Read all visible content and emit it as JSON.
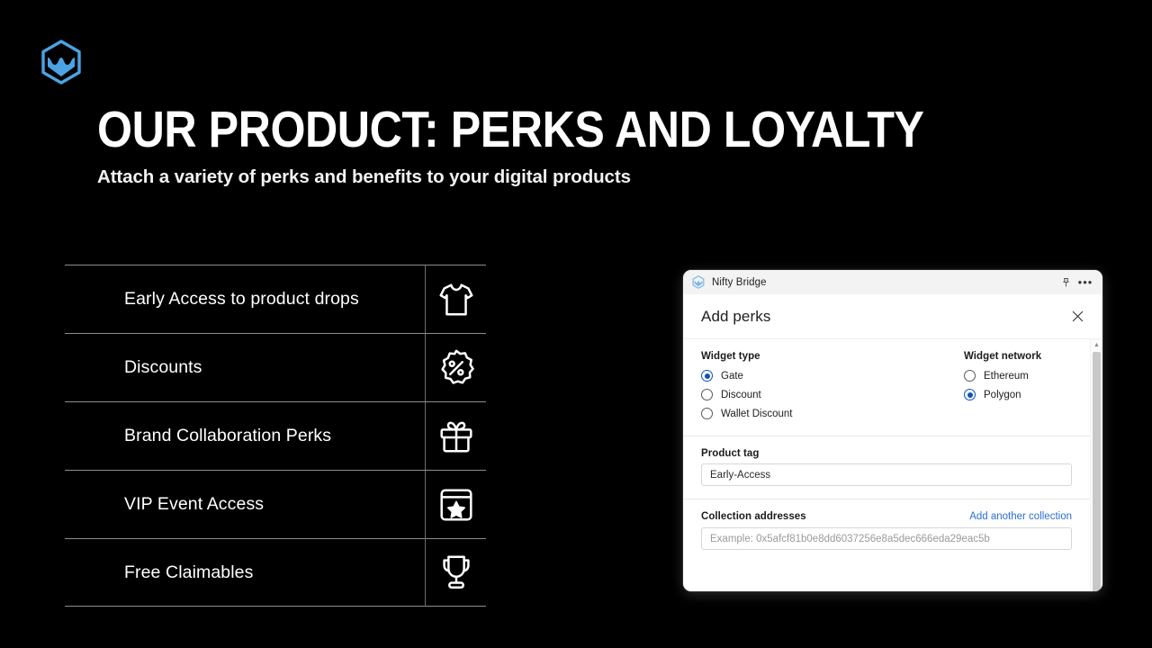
{
  "brand": {
    "logo_icon": "nifty-bridge-hexagon-logo",
    "accent_color": "#4BA3E3"
  },
  "slide": {
    "headline": "OUR PRODUCT: PERKS AND LOYALTY",
    "subhead": "Attach a variety of perks and benefits to your digital products",
    "background_color": "#000000"
  },
  "perks": [
    {
      "label": "Early Access to product drops",
      "icon": "tshirt-icon"
    },
    {
      "label": "Discounts",
      "icon": "percent-badge-icon"
    },
    {
      "label": "Brand Collaboration Perks",
      "icon": "gift-icon"
    },
    {
      "label": "VIP Event Access",
      "icon": "ticket-star-icon"
    },
    {
      "label": "Free Claimables",
      "icon": "trophy-icon"
    }
  ],
  "app_window": {
    "titlebar": {
      "app_name": "Nifty Bridge",
      "logo_icon": "nifty-bridge-hexagon-logo",
      "pin_icon": "pin-icon",
      "more_icon": "more-horizontal-icon"
    },
    "dialog": {
      "title": "Add perks",
      "close_icon": "close-icon",
      "widget_type": {
        "label": "Widget type",
        "options": [
          {
            "label": "Gate",
            "selected": true
          },
          {
            "label": "Discount",
            "selected": false
          },
          {
            "label": "Wallet Discount",
            "selected": false
          }
        ]
      },
      "widget_network": {
        "label": "Widget network",
        "options": [
          {
            "label": "Ethereum",
            "selected": false
          },
          {
            "label": "Polygon",
            "selected": true
          }
        ]
      },
      "product_tag": {
        "label": "Product tag",
        "value": "Early-Access",
        "placeholder": "Product tag"
      },
      "collection_addresses": {
        "label": "Collection addresses",
        "action_link": "Add another collection",
        "value": "",
        "placeholder": "Example: 0x5afcf81b0e8dd6037256e8a5dec666eda29eac5b"
      },
      "radio_selected_color": "#0F52BA",
      "link_color": "#2B6FD4"
    },
    "scrollbar": {
      "up_arrow_icon": "chevron-up-icon"
    }
  }
}
